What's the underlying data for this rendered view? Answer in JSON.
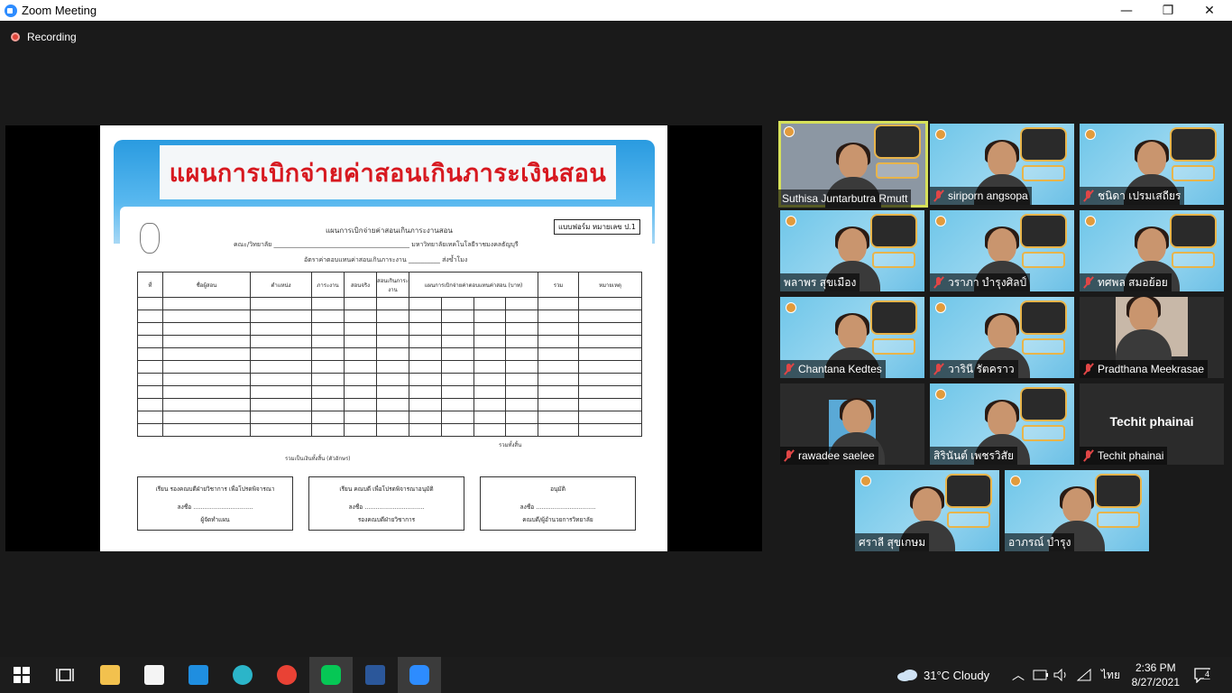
{
  "window": {
    "title": "Zoom Meeting",
    "minimize": "—",
    "restore": "❐",
    "close": "✕"
  },
  "recording": {
    "label": "Recording"
  },
  "slide": {
    "heading": "แผนการเบิกจ่ายค่าสอนเกินภาระเงินสอน",
    "form_badge": "แบบฟอร์ม หมายเลข ป.1",
    "doc_title": "แผนการเบิกจ่ายค่าสอนเกินภาระงานสอน",
    "faculty_line": "คณะ/วิทยาลัย ___________________________________________ มหาวิทยาลัยเทคโนโลยีราชมงคลธัญบุรี",
    "rate_line": "อัตราค่าตอบแทนค่าสอนเกินภาระงาน __________ ส่งข้ำโมง",
    "table_headers": [
      "ที่",
      "ชื่อผู้สอน",
      "ตำแหน่ง",
      "ภาระงาน",
      "สอนจริง",
      "สอนเกินภาระงาน",
      "แผนการเบิกจ่ายค่าตอบแทนค่าสอน (บาท)",
      "รวม",
      "หมายเหตุ"
    ],
    "total_label": "รวมทั้งสิ้น",
    "amount_note": "รวมเป็นเงินทั้งสิ้น (ตัวอักษร)",
    "box1": {
      "line1": "เรียน   รองคณบดีฝ่ายวิชาการ  เพื่อโปรดพิจารณา",
      "line2": "ลงชื่อ ................................",
      "line3": "ผู้จัดทำแผน"
    },
    "box2": {
      "line1": "เรียน   คณบดี  เพื่อโปรดพิจารณาอนุมัติ",
      "line2": "ลงชื่อ ................................",
      "line3": "รองคณบดีฝ่ายวิชาการ"
    },
    "box3": {
      "line1": "อนุมัติ",
      "line2": "ลงชื่อ ................................",
      "line3": "คณบดี/ผู้อำนวยการวิทยาลัย"
    }
  },
  "participants": [
    {
      "name": "Suthisa  Juntarbutra Rmutt",
      "muted": false,
      "active": true,
      "video": true
    },
    {
      "name": "siriporn angsopa",
      "muted": true,
      "active": false,
      "video": true
    },
    {
      "name": "ชนิดา เปรมเสถียร",
      "muted": true,
      "active": false,
      "video": true
    },
    {
      "name": "พลาพร สุขเมือง",
      "muted": false,
      "active": false,
      "video": true
    },
    {
      "name": "วราภา บำรุงศิลป์",
      "muted": true,
      "active": false,
      "video": true
    },
    {
      "name": "ทศพล สมอย้อย",
      "muted": true,
      "active": false,
      "video": true
    },
    {
      "name": "Chantana Kedtes",
      "muted": true,
      "active": false,
      "video": true
    },
    {
      "name": "วารินี รัตคราว",
      "muted": true,
      "active": false,
      "video": true
    },
    {
      "name": "Pradthana Meekrasae",
      "muted": true,
      "active": false,
      "video": true
    },
    {
      "name": "rawadee saelee",
      "muted": true,
      "active": false,
      "video": true
    },
    {
      "name": "สิรินันต์ เพชรวิสัย",
      "muted": false,
      "active": false,
      "video": true
    },
    {
      "name": "Techit phainai",
      "muted": true,
      "active": false,
      "video": false,
      "display_name": "Techit phainai"
    },
    {
      "name": "ศราลี  สุขเกษม",
      "muted": false,
      "active": false,
      "video": true
    },
    {
      "name": "อาภรณ์  บำรุง",
      "muted": false,
      "active": false,
      "video": true
    }
  ],
  "taskbar": {
    "weather": "31°C  Cloudy",
    "language": "ไทย",
    "time": "2:36 PM",
    "date": "8/27/2021",
    "notifications": "4",
    "icons": [
      "windows-start",
      "task-view",
      "file-explorer",
      "microsoft-store",
      "mail",
      "edge",
      "chrome",
      "line",
      "word",
      "zoom"
    ],
    "colors": {
      "explorer": "#f2c14e",
      "store": "#f4f4f4",
      "mail": "#1f8ee0",
      "edge": "#2bb5c9",
      "chrome": "#e94235",
      "line": "#06c755",
      "word": "#2b579a",
      "zoom": "#2d8cff"
    }
  }
}
